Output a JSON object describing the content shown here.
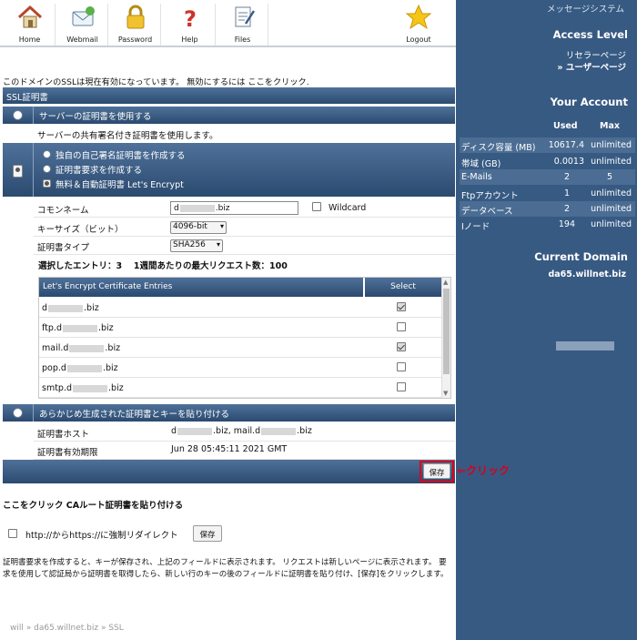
{
  "toolbar": {
    "home": "Home",
    "webmail": "Webmail",
    "password": "Password",
    "help": "Help",
    "files": "Files",
    "logout": "Logout"
  },
  "status_msg": {
    "text": "このドメインのSSLは現在有効になっています。 無効にするには ",
    "link": "ここをクリック",
    "end": "."
  },
  "ssl": {
    "header": "SSL証明書",
    "server_cert_option": "サーバーの証明書を使用する",
    "server_cert_desc": "サーバーの共有署名付き証明書を使用します。",
    "create_options": [
      "独自の自己署名証明書を作成する",
      "証明書要求を作成する",
      "無料＆自動証明書 Let's Encrypt"
    ],
    "common_name_label": "コモンネーム",
    "common_name_prefix": "d",
    "common_name_suffix": ".biz",
    "wildcard_label": "Wildcard",
    "key_size_label": "キーサイズ（ビット）",
    "key_size_value": "4096-bit",
    "cert_type_label": "証明書タイプ",
    "cert_type_value": "SHA256",
    "selected_info": "選択したエントリ：3　 1週間あたりの最大リクエスト数：100",
    "entries_header": "Let's Encrypt Certificate Entries",
    "entries_select": "Select",
    "entries": [
      {
        "pre": "d",
        "post": ".biz",
        "checked": true
      },
      {
        "pre": "ftp.d",
        "post": ".biz",
        "checked": false
      },
      {
        "pre": "mail.d",
        "post": ".biz",
        "checked": true
      },
      {
        "pre": "pop.d",
        "post": ".biz",
        "checked": false
      },
      {
        "pre": "smtp.d",
        "post": ".biz",
        "checked": false
      }
    ],
    "paste_option": "あらかじめ生成された証明書とキーを貼り付ける",
    "host_label": "証明書ホスト",
    "host_a": "d",
    "host_b": ".biz, mail.d",
    "host_c": ".biz",
    "expiry_label": "証明書有効期限",
    "expiry_value": "Jun 28 05:45:11 2021 GMT",
    "save_button": "保存"
  },
  "annotation": "⇐クリック",
  "ca_link": "ここをクリック CAルート証明書を貼り付ける",
  "redirect_label": "http://からhttps://に強制リダイレクト",
  "redirect_save": "保存",
  "help_text": "証明書要求を作成すると、キーが保存され、上記のフィールドに表示されます。 リクエストは新しいページに表示されます。 要求を使用して認証局から証明書を取得したら、新しい行のキーの後のフィールドに証明書を貼り付け、[保存]をクリックします。",
  "breadcrumb": [
    "will",
    "da65.willnet.biz",
    "SSL"
  ],
  "sidebar": {
    "message_system": "メッセージシステム",
    "access_level_title": "Access Level",
    "reseller": "リセラーページ",
    "user_page": "» ユーザーページ",
    "your_account_title": "Your Account",
    "col_used": "Used",
    "col_max": "Max",
    "stats": [
      {
        "label": "ディスク容量 (MB)",
        "used": "10617.4",
        "max": "unlimited"
      },
      {
        "label": "帯域 (GB)",
        "used": "0.0013",
        "max": "unlimited"
      },
      {
        "label": "E-Mails",
        "used": "2",
        "max": "5"
      },
      {
        "label": "Ftpアカウント",
        "used": "1",
        "max": "unlimited"
      },
      {
        "label": "データベース",
        "used": "2",
        "max": "unlimited"
      },
      {
        "label": "Iノード",
        "used": "194",
        "max": "unlimited"
      }
    ],
    "current_domain_title": "Current Domain",
    "current_domain": "da65.willnet.biz"
  },
  "colors": {
    "bar": "#375a83",
    "annotation": "#d9001b"
  }
}
